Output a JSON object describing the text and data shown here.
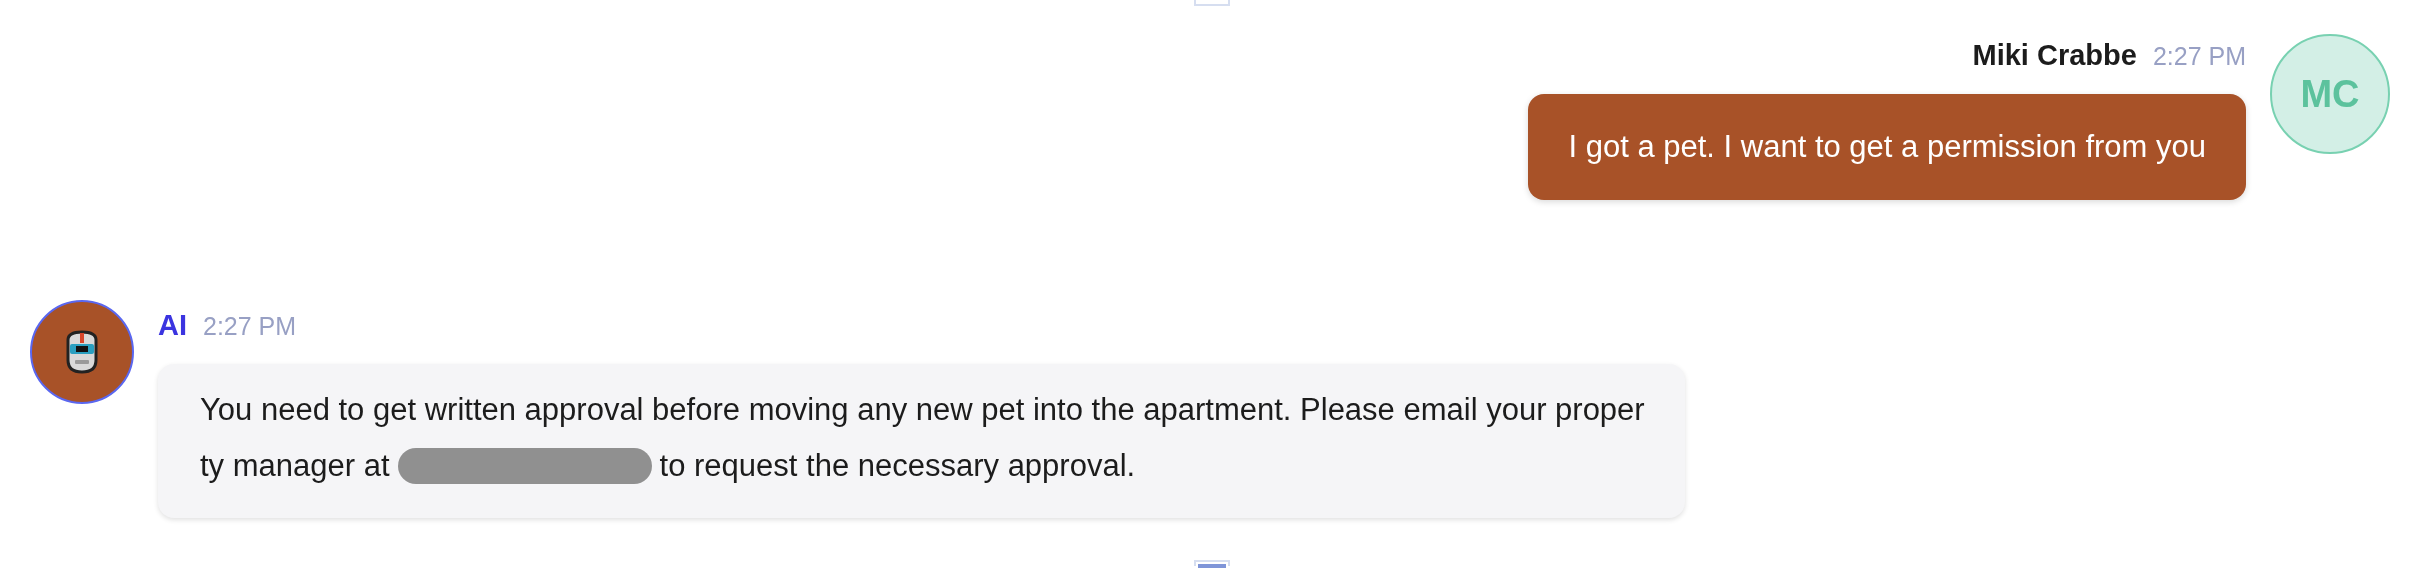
{
  "messages": [
    {
      "kind": "user",
      "sender": "Miki Crabbe",
      "time": "2:27 PM",
      "avatar_initials": "MC",
      "lines": [
        "I got a pet. I want to get a permission from you"
      ]
    },
    {
      "kind": "bot",
      "sender": "AI",
      "time": "2:27 PM",
      "lines": [
        "You need to get written approval before moving any new pet into the apartment. Please email your proper",
        "ty manager at"
      ],
      "redacted": true,
      "after_redaction": "to request the necessary approval."
    }
  ]
}
